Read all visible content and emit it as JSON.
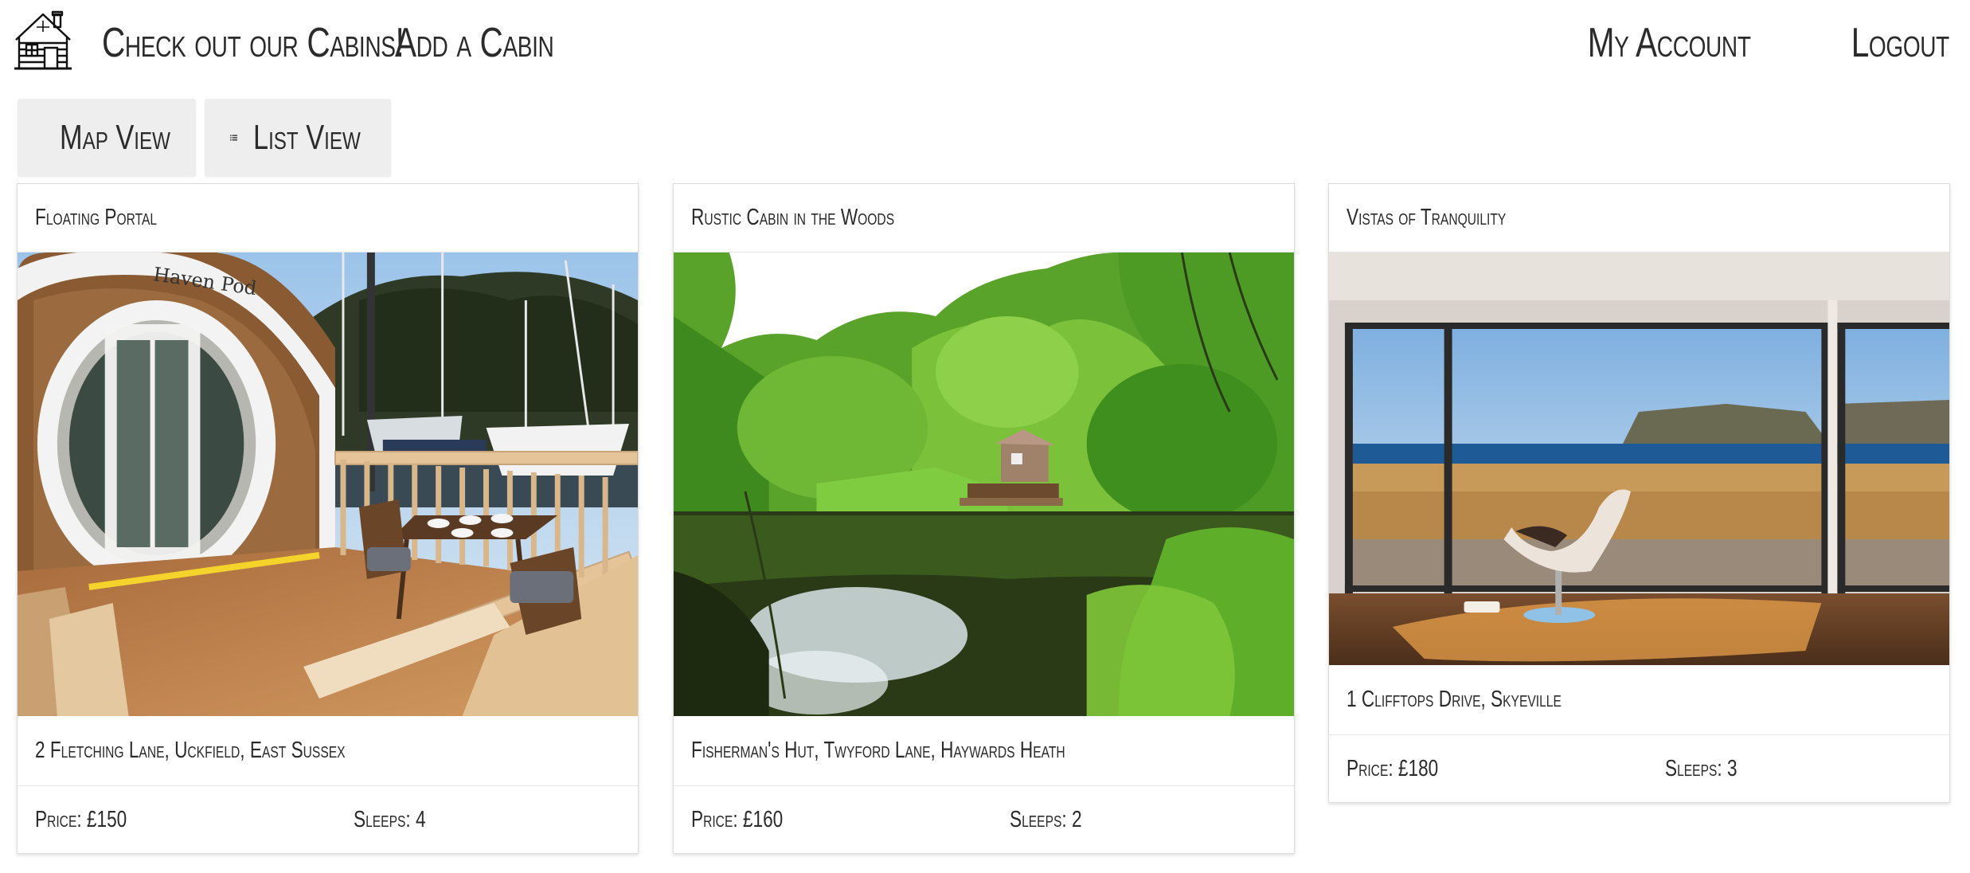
{
  "nav": {
    "logo_icon": "cabin-icon",
    "links_left": [
      "Check out our Cabins!",
      "Add a Cabin"
    ],
    "links_right": [
      "My Account",
      "Logout"
    ]
  },
  "views": {
    "map_label": "Map View",
    "map_icon": "map-pin-icon",
    "list_label": "List View",
    "list_icon": "list-icon"
  },
  "cabins": [
    {
      "title": "Floating Portal",
      "image_desc": "Haven Pod",
      "address": "2 Fletching Lane, Uckfield, East Sussex",
      "price": "Price: £150",
      "sleeps": "Sleeps: 4"
    },
    {
      "title": "Rustic Cabin in the Woods",
      "address": "Fisherman's Hut, Twyford Lane, Haywards Heath",
      "price": "Price: £160",
      "sleeps": "Sleeps: 2"
    },
    {
      "title": "Vistas of Tranquility",
      "address": "1 Clifftops Drive, Skyeville",
      "price": "Price: £180",
      "sleeps": "Sleeps: 3"
    }
  ]
}
